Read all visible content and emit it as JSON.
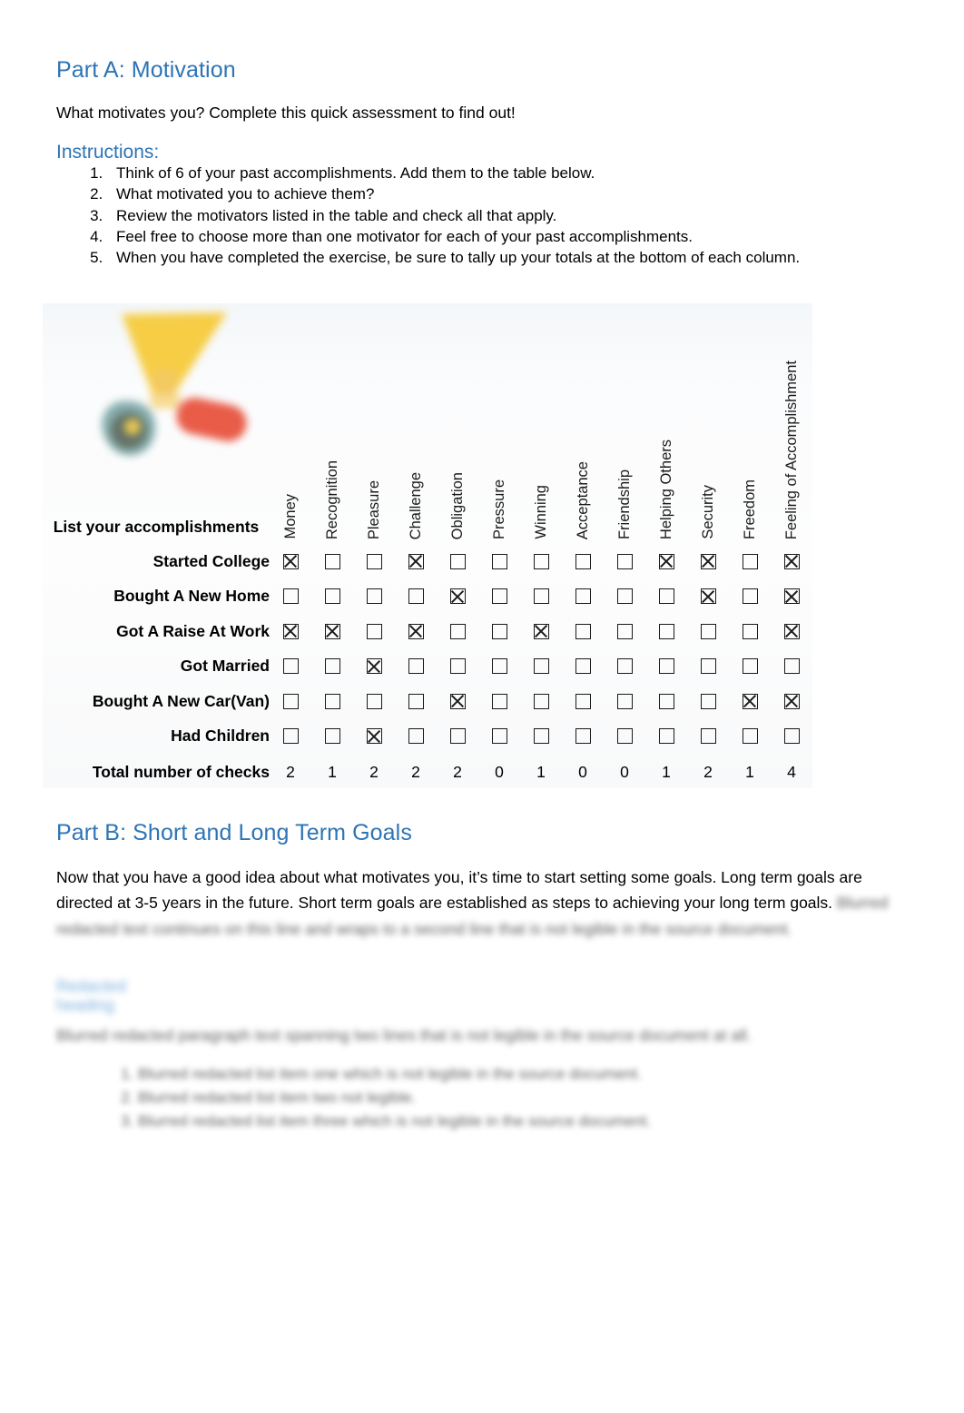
{
  "part_a": {
    "title": "Part A: Motivation",
    "intro": "What motivates you? Complete this quick assessment to find out!",
    "instructions_title": "Instructions:",
    "instructions": [
      "Think of 6 of your past accomplishments. Add them to the table below.",
      "What motivated you to achieve them?",
      "Review the motivators listed in the table and check all that apply.",
      "Feel free to choose more than one motivator for each of your past accomplishments.",
      "When you have completed the exercise, be sure to tally up your totals at the bottom of each column."
    ]
  },
  "table": {
    "row_header_label": "List your accomplishments",
    "trophy_icon": "trophy-award-icon",
    "columns": [
      "Money",
      "Recognition",
      "Pleasure",
      "Challenge",
      "Obligation",
      "Pressure",
      "Winning",
      "Acceptance",
      "Friendship",
      "Helping Others",
      "Security",
      "Freedom",
      "Feeling of Accomplishment"
    ],
    "rows": [
      {
        "label": "Started College",
        "checks": [
          1,
          0,
          0,
          1,
          0,
          0,
          0,
          0,
          0,
          1,
          1,
          0,
          1
        ]
      },
      {
        "label": "Bought A New Home",
        "checks": [
          0,
          0,
          0,
          0,
          1,
          0,
          0,
          0,
          0,
          0,
          1,
          0,
          1
        ]
      },
      {
        "label": "Got A Raise At Work",
        "checks": [
          1,
          1,
          0,
          1,
          0,
          0,
          1,
          0,
          0,
          0,
          0,
          0,
          1
        ]
      },
      {
        "label": "Got Married",
        "checks": [
          0,
          0,
          1,
          0,
          0,
          0,
          0,
          0,
          0,
          0,
          0,
          0,
          0
        ]
      },
      {
        "label": "Bought A New Car(Van)",
        "checks": [
          0,
          0,
          0,
          0,
          1,
          0,
          0,
          0,
          0,
          0,
          0,
          1,
          1
        ]
      },
      {
        "label": "Had Children",
        "checks": [
          0,
          0,
          1,
          0,
          0,
          0,
          0,
          0,
          0,
          0,
          0,
          0,
          0
        ]
      }
    ],
    "totals_label": "Total number of checks",
    "totals": [
      2,
      1,
      2,
      2,
      2,
      0,
      1,
      0,
      0,
      1,
      2,
      1,
      4
    ],
    "checked_glyph": "checkbox-checked",
    "unchecked_glyph": "checkbox-empty"
  },
  "part_b": {
    "title": "Part B: Short and Long Term Goals",
    "paragraph_visible": "Now that you have a good idea about what motivates you, it’s time to start setting some goals. Long term goals are directed at 3-5 years in the future.  Short term goals are established as steps to achieving your long term goals.",
    "paragraph_redacted": "Blurred redacted text continues on this line and wraps to a second line that is not legible in the source document.",
    "redacted_heading": "Redacted heading",
    "redacted_paragraph": "Blurred redacted paragraph text spanning two lines that is not legible in the source document at all.",
    "redacted_list": [
      "Blurred redacted list item one which is not legible in the source document.",
      "Blurred redacted list item two not legible.",
      "Blurred redacted list item three which is not legible in the source document."
    ]
  },
  "colors": {
    "heading_blue": "#2E74B5",
    "table_background": "#F8FAFB",
    "text_black": "#000000",
    "trophy_gold": "#F2C230",
    "trophy_red": "#E8543F",
    "trophy_teal": "#7FA8A8"
  }
}
